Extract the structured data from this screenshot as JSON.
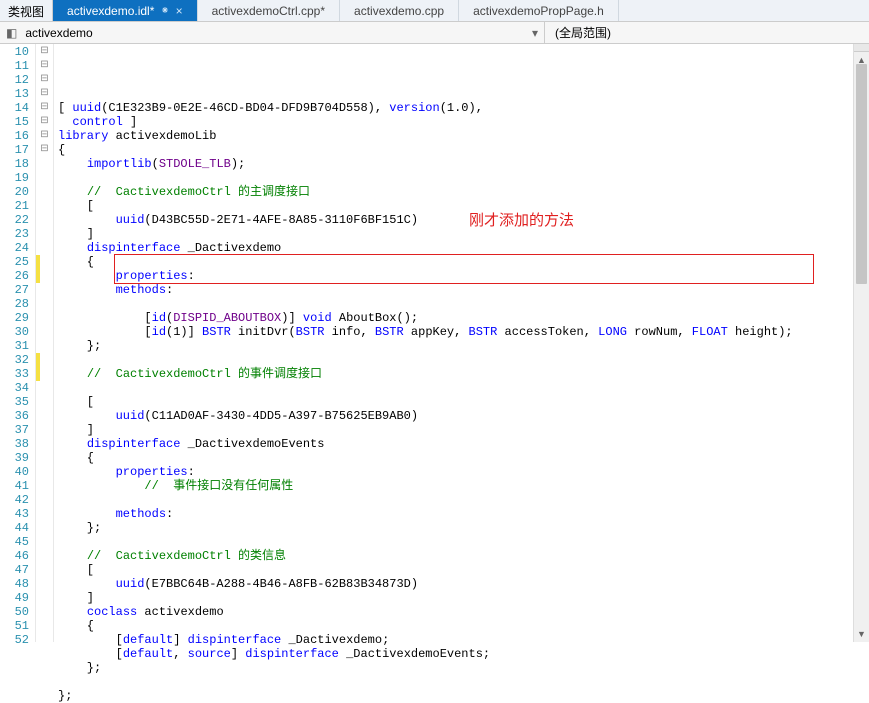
{
  "topbar": {
    "view_label": "类视图"
  },
  "tabs": [
    {
      "label": "activexdemo.idl*",
      "active": true,
      "pinned": true,
      "closable": true
    },
    {
      "label": "activexdemoCtrl.cpp*",
      "active": false
    },
    {
      "label": "activexdemo.cpp",
      "active": false
    },
    {
      "label": "activexdemoPropPage.h",
      "active": false
    }
  ],
  "scope": {
    "left": "activexdemo",
    "right": "(全局范围)"
  },
  "annotation": "刚才添加的方法",
  "lines": [
    {
      "n": 10,
      "html": "[ <span class='kw'>uuid</span>(C1E323B9-0E2E-46CD-BD04-DFD9B704D558), <span class='kw'>version</span>(1.0),"
    },
    {
      "n": 11,
      "html": "  <span class='kw'>control</span> ]"
    },
    {
      "n": 12,
      "html": "<span class='kw'>library</span> activexdemoLib"
    },
    {
      "n": 13,
      "html": "{"
    },
    {
      "n": 14,
      "html": "    <span class='kw'>importlib</span>(<span class='mac'>STDOLE_TLB</span>);"
    },
    {
      "n": 15,
      "html": ""
    },
    {
      "n": 16,
      "html": "    <span class='cmt'>//  CactivexdemoCtrl 的主调度接口</span>"
    },
    {
      "n": 17,
      "html": "    ["
    },
    {
      "n": 18,
      "html": "        <span class='kw'>uuid</span>(D43BC55D-2E71-4AFE-8A85-3110F6BF151C)"
    },
    {
      "n": 19,
      "html": "    ]"
    },
    {
      "n": 20,
      "html": "    <span class='kw'>dispinterface</span> _Dactivexdemo"
    },
    {
      "n": 21,
      "html": "    {"
    },
    {
      "n": 22,
      "html": "        <span class='kw'>properties</span>:"
    },
    {
      "n": 23,
      "html": "        <span class='kw'>methods</span>:"
    },
    {
      "n": 24,
      "html": ""
    },
    {
      "n": 25,
      "html": "            [<span class='kw'>id</span>(<span class='mac'>DISPID_ABOUTBOX</span>)] <span class='typ'>void</span> AboutBox();"
    },
    {
      "n": 26,
      "html": "            [<span class='kw'>id</span>(1)] <span class='typ'>BSTR</span> initDvr(<span class='typ'>BSTR</span> info, <span class='typ'>BSTR</span> appKey, <span class='typ'>BSTR</span> accessToken, <span class='typ'>LONG</span> rowNum, <span class='typ'>FLOAT</span> height);"
    },
    {
      "n": 27,
      "html": "    };"
    },
    {
      "n": 28,
      "html": ""
    },
    {
      "n": 29,
      "html": "    <span class='cmt'>//  CactivexdemoCtrl 的事件调度接口</span>"
    },
    {
      "n": 30,
      "html": ""
    },
    {
      "n": 31,
      "html": "    ["
    },
    {
      "n": 32,
      "html": "        <span class='kw'>uuid</span>(C11AD0AF-3430-4DD5-A397-B75625EB9AB0)"
    },
    {
      "n": 33,
      "html": "    ]"
    },
    {
      "n": 34,
      "html": "    <span class='kw'>dispinterface</span> _DactivexdemoEvents"
    },
    {
      "n": 35,
      "html": "    {"
    },
    {
      "n": 36,
      "html": "        <span class='kw'>properties</span>:"
    },
    {
      "n": 37,
      "html": "            <span class='cmt'>//  事件接口没有任何属性</span>"
    },
    {
      "n": 38,
      "html": ""
    },
    {
      "n": 39,
      "html": "        <span class='kw'>methods</span>:"
    },
    {
      "n": 40,
      "html": "    };"
    },
    {
      "n": 41,
      "html": ""
    },
    {
      "n": 42,
      "html": "    <span class='cmt'>//  CactivexdemoCtrl 的类信息</span>"
    },
    {
      "n": 43,
      "html": "    ["
    },
    {
      "n": 44,
      "html": "        <span class='kw'>uuid</span>(E7BBC64B-A288-4B46-A8FB-62B83B34873D)"
    },
    {
      "n": 45,
      "html": "    ]"
    },
    {
      "n": 46,
      "html": "    <span class='kw'>coclass</span> activexdemo"
    },
    {
      "n": 47,
      "html": "    {"
    },
    {
      "n": 48,
      "html": "        [<span class='kw'>default</span>] <span class='kw'>dispinterface</span> _Dactivexdemo;"
    },
    {
      "n": 49,
      "html": "        [<span class='kw'>default</span>, <span class='kw'>source</span>] <span class='kw'>dispinterface</span> _DactivexdemoEvents;"
    },
    {
      "n": 50,
      "html": "    };"
    },
    {
      "n": 51,
      "html": ""
    },
    {
      "n": 52,
      "html": "};"
    }
  ],
  "outline": [
    "⊟",
    "",
    "",
    "⊟",
    "",
    "",
    "",
    "⊟",
    "",
    "",
    "",
    "⊟",
    "",
    "",
    "",
    "",
    "",
    "",
    "",
    "",
    "⊟",
    "",
    "",
    "",
    "⊟",
    "",
    "",
    "",
    "",
    "",
    "",
    "",
    "",
    "⊟",
    "",
    "",
    "",
    "⊟",
    "",
    "",
    "",
    "",
    ""
  ],
  "yellow_marks": [
    25,
    26,
    32,
    33
  ]
}
